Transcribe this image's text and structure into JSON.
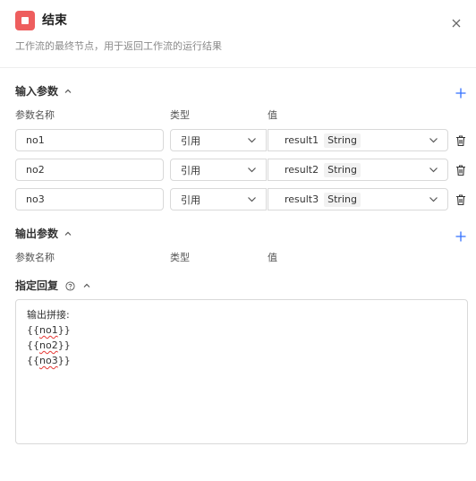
{
  "header": {
    "title": "结束",
    "description": "工作流的最终节点，用于返回工作流的运行结果",
    "node_icon": "stop-square-icon",
    "accent": "#ee5e5e"
  },
  "input_section": {
    "title": "输入参数",
    "columns": {
      "name": "参数名称",
      "type": "类型",
      "value": "值"
    },
    "rows": [
      {
        "name": "no1",
        "type": "引用",
        "value": "result1",
        "value_type": "String"
      },
      {
        "name": "no2",
        "type": "引用",
        "value": "result2",
        "value_type": "String"
      },
      {
        "name": "no3",
        "type": "引用",
        "value": "result3",
        "value_type": "String"
      }
    ]
  },
  "output_section": {
    "title": "输出参数",
    "columns": {
      "name": "参数名称",
      "type": "类型",
      "value": "值"
    }
  },
  "reply_section": {
    "title": "指定回复",
    "content": {
      "line1": "输出拼接:",
      "line2_prefix": "{{",
      "line2_var": "no1",
      "line2_suffix": "}}",
      "line3_prefix": "{{",
      "line3_var": "no2",
      "line3_suffix": "}}",
      "line4_prefix": "{{",
      "line4_var": "no3",
      "line4_suffix": "}}"
    }
  },
  "colors": {
    "link": "#3370ff",
    "border": "#d9d9d9"
  }
}
